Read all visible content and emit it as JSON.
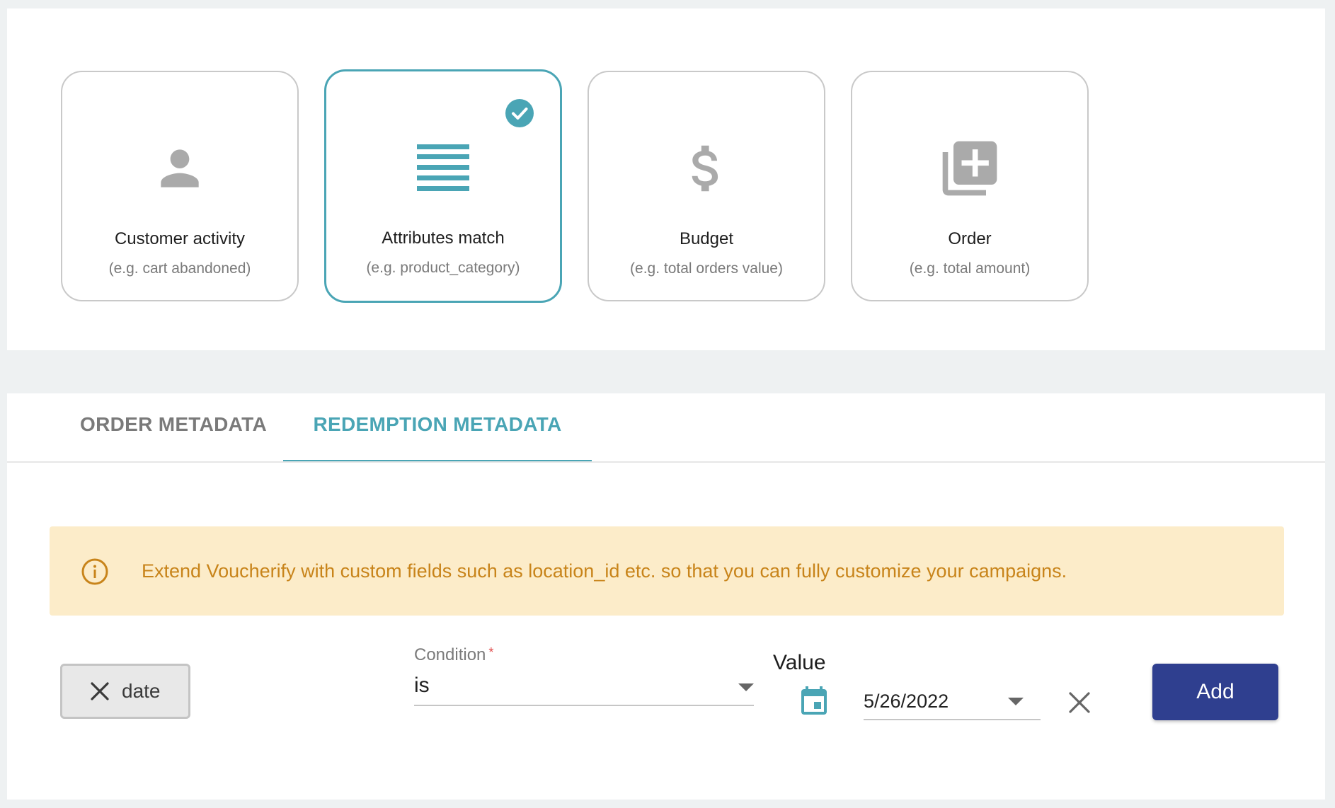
{
  "cards": [
    {
      "title": "Customer activity",
      "subtitle": "(e.g. cart abandoned)",
      "icon": "person-icon",
      "selected": false
    },
    {
      "title": "Attributes match",
      "subtitle": "(e.g. product_category)",
      "icon": "list-lines-icon",
      "selected": true
    },
    {
      "title": "Budget",
      "subtitle": "(e.g. total orders value)",
      "icon": "dollar-icon",
      "selected": false
    },
    {
      "title": "Order",
      "subtitle": "(e.g. total amount)",
      "icon": "add-to-collection-icon",
      "selected": false
    }
  ],
  "tabs": [
    {
      "label": "ORDER METADATA",
      "active": false
    },
    {
      "label": "REDEMPTION METADATA",
      "active": true
    }
  ],
  "info_banner": {
    "icon": "info-icon",
    "text": "Extend Voucherify with custom fields such as location_id etc. so that you can fully customize your campaigns."
  },
  "rule": {
    "chip_label": "date",
    "condition": {
      "label": "Condition",
      "required_mark": "*",
      "value": "is"
    },
    "value_field": {
      "label": "Value",
      "date": "5/26/2022"
    },
    "add_button": "Add"
  },
  "colors": {
    "accent": "#4aa5b5",
    "primary_button": "#2f3f8f",
    "banner_bg": "#fcecc9",
    "banner_text": "#c8841a",
    "icon_grey": "#aaaaaa"
  }
}
